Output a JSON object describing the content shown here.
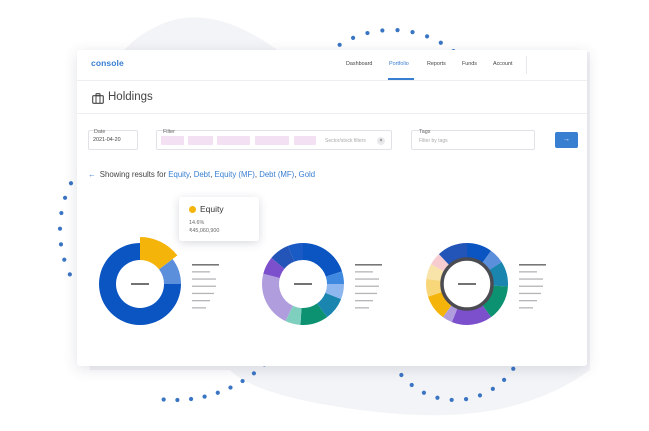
{
  "app": {
    "logo": "console"
  },
  "nav": {
    "items": [
      {
        "label": "Dashboard",
        "active": false
      },
      {
        "label": "Portfolio",
        "active": true
      },
      {
        "label": "Reports",
        "active": false
      },
      {
        "label": "Funds",
        "active": false
      },
      {
        "label": "Account",
        "active": false
      }
    ]
  },
  "page": {
    "title": "Holdings",
    "title_icon": "briefcase-icon"
  },
  "filters": {
    "date_label": "Date",
    "date_value": "2021-04-20",
    "filter_label": "Filter",
    "filter_placeholder": "Sector/stock filters",
    "clear_icon": "×",
    "tags_label": "Tags",
    "tags_placeholder": "Filter by tags",
    "go_icon": "→"
  },
  "results": {
    "back_icon": "←",
    "prefix": "Showing results for",
    "assets": [
      "Equity",
      "Debt",
      "Equity (MF)",
      "Debt (MF)",
      "Gold"
    ]
  },
  "tooltip": {
    "name": "Equity",
    "percent": "14.6%",
    "amount": "₹45,060,900",
    "color": "#f5b40a"
  },
  "colors": {
    "accent": "#387ed1",
    "dots": "#3a75c4"
  },
  "chart_data": [
    {
      "type": "pie",
      "variant": "donut",
      "slices": [
        {
          "value": 14.6,
          "color": "#f5b40a",
          "highlight": true
        },
        {
          "value": 10.4,
          "color": "#5b8fdc"
        },
        {
          "value": 75.0,
          "color": "#0a55c2"
        }
      ]
    },
    {
      "type": "pie",
      "variant": "donut",
      "slices": [
        {
          "value": 20,
          "color": "#0a55c2"
        },
        {
          "value": 5,
          "color": "#3f8ae0"
        },
        {
          "value": 6,
          "color": "#8fb7ef"
        },
        {
          "value": 9,
          "color": "#1a86b0"
        },
        {
          "value": 11,
          "color": "#0c9171"
        },
        {
          "value": 6,
          "color": "#7fcfbf"
        },
        {
          "value": 22,
          "color": "#b09ddd"
        },
        {
          "value": 7,
          "color": "#7c4fcc"
        },
        {
          "value": 8,
          "color": "#2354b8"
        },
        {
          "value": 6,
          "color": "#1a5ac5"
        }
      ]
    },
    {
      "type": "pie",
      "variant": "donut",
      "slices": [
        {
          "value": 10,
          "color": "#0a55c2"
        },
        {
          "value": 6,
          "color": "#5b8fdc"
        },
        {
          "value": 10,
          "color": "#1a86b0"
        },
        {
          "value": 14,
          "color": "#0c9171"
        },
        {
          "value": 16,
          "color": "#7c4fcc"
        },
        {
          "value": 4,
          "color": "#b09ddd"
        },
        {
          "value": 10,
          "color": "#f5b40a"
        },
        {
          "value": 7,
          "color": "#f8d67a"
        },
        {
          "value": 6,
          "color": "#f8e4a8"
        },
        {
          "value": 5,
          "color": "#f6ccd0"
        },
        {
          "value": 12,
          "color": "#2354b8"
        }
      ]
    }
  ]
}
